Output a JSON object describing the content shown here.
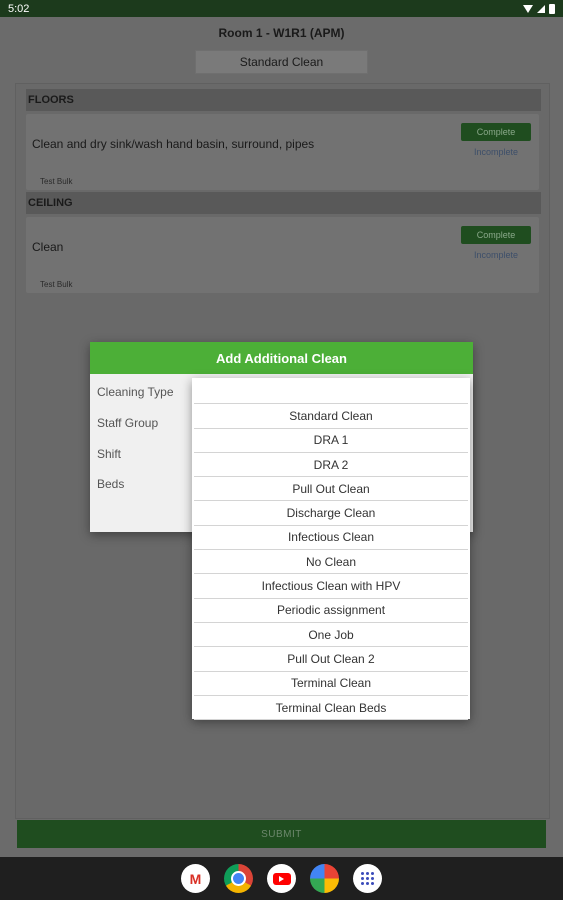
{
  "status_bar": {
    "time": "5:02"
  },
  "header": {
    "room_title": "Room 1 - W1R1 (APM)",
    "clean_type": "Standard Clean"
  },
  "sections": [
    {
      "title": "FLOORS",
      "task": {
        "text": "Clean and dry sink/wash hand basin, surround, pipes",
        "tag": "Test Bulk",
        "complete_label": "Complete",
        "incomplete_label": "Incomplete"
      }
    },
    {
      "title": "CEILING",
      "task": {
        "text": "Clean",
        "tag": "Test Bulk",
        "complete_label": "Complete",
        "incomplete_label": "Incomplete"
      }
    }
  ],
  "submit_label": "SUBMIT",
  "modal": {
    "title": "Add Additional Clean",
    "labels": {
      "cleaning_type": "Cleaning Type",
      "staff_group": "Staff Group",
      "shift": "Shift",
      "beds": "Beds"
    }
  },
  "dropdown": {
    "selected": "",
    "options": [
      "Standard Clean",
      "DRA 1",
      "DRA 2",
      "Pull Out Clean",
      "Discharge Clean",
      "Infectious Clean",
      "No Clean",
      "Infectious Clean with HPV",
      "Periodic assignment",
      "One Job",
      "Pull Out Clean 2",
      "Terminal Clean",
      "Terminal Clean Beds"
    ]
  },
  "dock": {
    "apps": [
      "gmail-icon",
      "chrome-icon",
      "youtube-icon",
      "photos-icon",
      "apps-icon"
    ]
  },
  "colors": {
    "accent_green": "#4caf37",
    "dark_green": "#1f4d1f"
  }
}
